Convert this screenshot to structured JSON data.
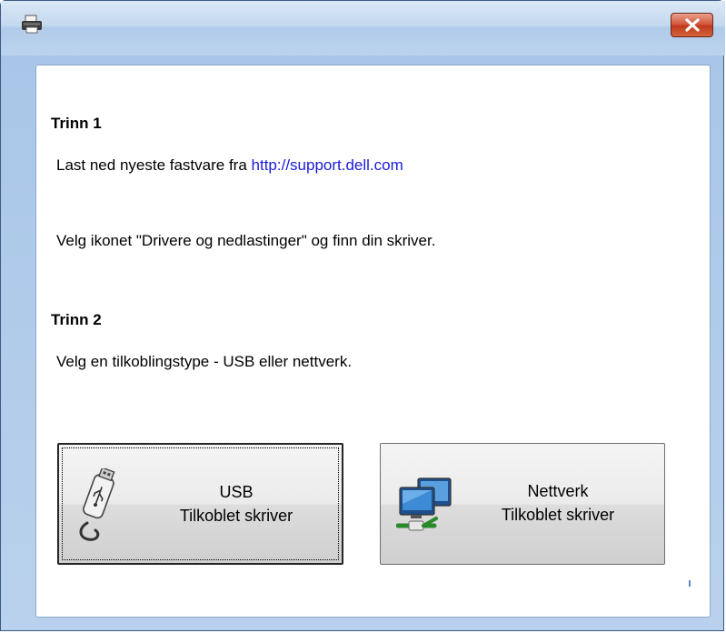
{
  "window": {
    "close_label": "✕"
  },
  "step1": {
    "heading": "Trinn 1",
    "download_text": "Last ned nyeste fastvare fra ",
    "download_link": "http://support.dell.com",
    "instruction": "Velg ikonet \"Drivere og nedlastinger\" og finn din skriver."
  },
  "step2": {
    "heading": "Trinn 2",
    "instruction": "Velg en tilkoblingstype - USB eller nettverk."
  },
  "buttons": {
    "usb": {
      "line1": "USB",
      "line2": "Tilkoblet skriver",
      "icon": "usb-icon"
    },
    "network": {
      "line1": "Nettverk",
      "line2": "Tilkoblet skriver",
      "icon": "network-icon"
    }
  }
}
